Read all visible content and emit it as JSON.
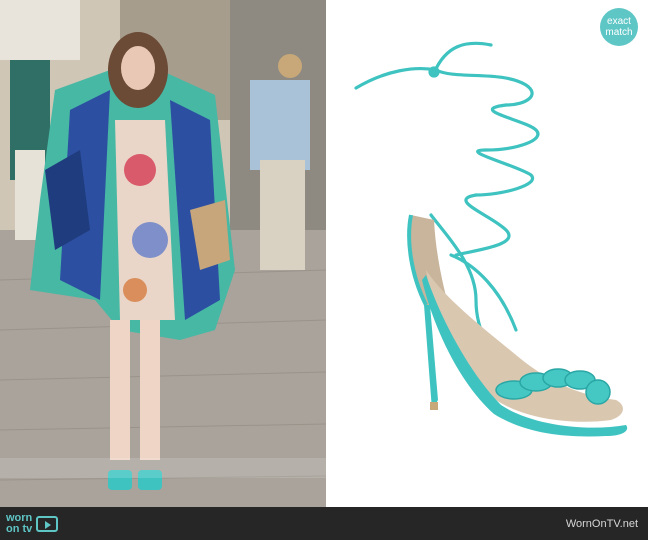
{
  "badge": {
    "line1": "exact",
    "line2": "match"
  },
  "footer": {
    "logo_line1": "worn",
    "logo_line2": "on tv",
    "site": "WornOnTV.net"
  },
  "colors": {
    "accent": "#5fc6c6",
    "footer_bg": "#262626",
    "sandal": "#3ec3c1"
  }
}
